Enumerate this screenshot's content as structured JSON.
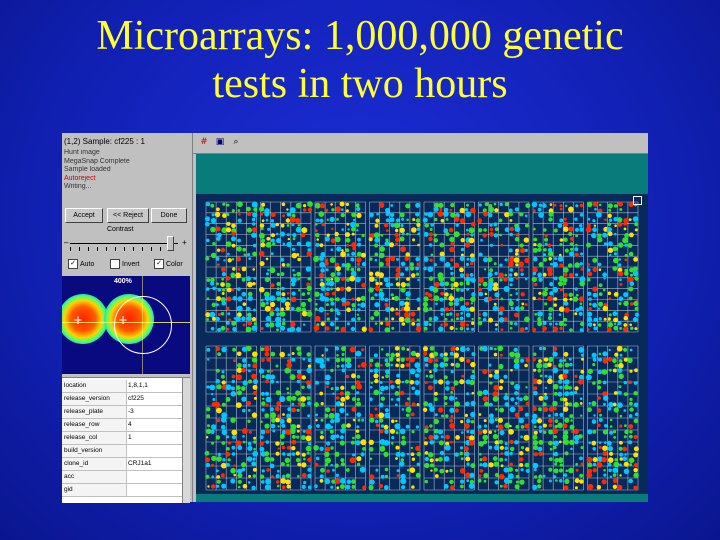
{
  "slide": {
    "title_line1": "Microarrays: 1,000,000 genetic",
    "title_line2": "tests in two hours"
  },
  "app": {
    "window_title": "(1,2) Sample: cf225 : 1",
    "status_lines": [
      {
        "text": "Hunt image",
        "color": "#333333"
      },
      {
        "text": "MegaSnap Complete",
        "color": "#333333"
      },
      {
        "text": "Sample loaded",
        "color": "#333333"
      },
      {
        "text": "Autoreject",
        "color": "#d00000"
      },
      {
        "text": "Writing...",
        "color": "#333333"
      }
    ],
    "buttons": {
      "accept": "Accept",
      "reject": "<< Reject",
      "done": "Done"
    },
    "contrast_label": "Contrast",
    "slider_minus": "–",
    "slider_plus": "+",
    "checkboxes": [
      {
        "label": "Auto",
        "checked": true
      },
      {
        "label": "Invert",
        "checked": false
      },
      {
        "label": "Color",
        "checked": true
      }
    ],
    "zoom_label": "400%",
    "properties": [
      {
        "key": "location",
        "value": "1,8,1,1"
      },
      {
        "key": "release_version",
        "value": "cf225"
      },
      {
        "key": "release_plate",
        "value": "-3"
      },
      {
        "key": "release_row",
        "value": "4"
      },
      {
        "key": "release_col",
        "value": "1"
      },
      {
        "key": "build_version",
        "value": ""
      },
      {
        "key": "clone_id",
        "value": "CRJ1a1"
      },
      {
        "key": "acc",
        "value": ""
      },
      {
        "key": "gid",
        "value": ""
      }
    ],
    "toolbar_icons": [
      "grid-icon",
      "save-icon",
      "zoom-icon"
    ],
    "colors": {
      "slide_background": "#1222b8",
      "title_yellow": "#ffff33",
      "teal_band": "#0a7b7b",
      "array_background": "#072a5a",
      "spot_red": "#ff2a00",
      "spot_yellow": "#ffe000",
      "spot_green": "#30e030",
      "spot_cyan": "#00c8ff",
      "grid_line": "#e8e8e8"
    }
  }
}
